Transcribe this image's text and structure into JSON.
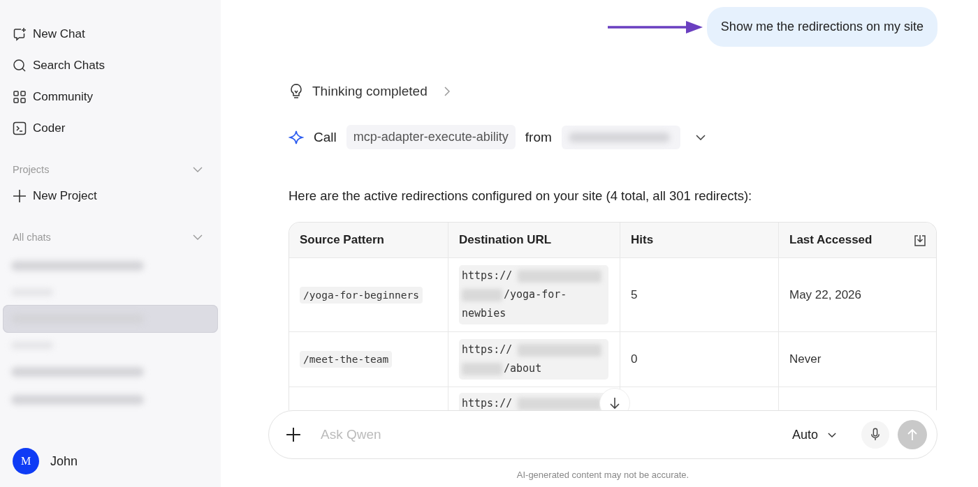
{
  "sidebar": {
    "nav": [
      {
        "kind": "new-chat",
        "label": "New Chat"
      },
      {
        "kind": "search",
        "label": "Search Chats"
      },
      {
        "kind": "community",
        "label": "Community"
      },
      {
        "kind": "coder",
        "label": "Coder"
      }
    ],
    "projects": {
      "title": "Projects",
      "new_project": "New Project"
    },
    "all_chats": {
      "title": "All chats",
      "items": [
        {
          "kind": "chat",
          "selected": false
        },
        {
          "kind": "group"
        },
        {
          "kind": "chat",
          "selected": true
        },
        {
          "kind": "group"
        },
        {
          "kind": "chat",
          "selected": false
        },
        {
          "kind": "chat",
          "selected": false
        }
      ]
    },
    "user": {
      "initial": "M",
      "name": "John"
    }
  },
  "user_message": "Show me the redirections on my site",
  "thinking": {
    "label": "Thinking completed"
  },
  "tool_call": {
    "verb": "Call",
    "tool": "mcp-adapter-execute-ability",
    "from": "from"
  },
  "intro": "Here are the active redirections configured on your site (4 total, all 301 redirects):",
  "table": {
    "columns": [
      "Source Pattern",
      "Destination URL",
      "Hits",
      "Last Accessed"
    ],
    "rows": [
      {
        "source": "/yoga-for-beginners",
        "destination_prefix": "https://",
        "destination_suffix": "/yoga-for-newbies",
        "hits": "5",
        "last_accessed": "May 22, 2026"
      },
      {
        "source": "/meet-the-team",
        "destination_prefix": "https://",
        "destination_suffix": "/about",
        "hits": "0",
        "last_accessed": "Never"
      },
      {
        "destination_prefix": "https://"
      }
    ]
  },
  "composer": {
    "placeholder": "Ask Qwen",
    "model": "Auto"
  },
  "disclaimer": "AI-generated content may not be accurate."
}
